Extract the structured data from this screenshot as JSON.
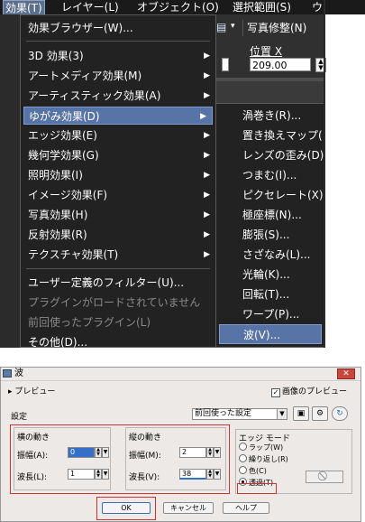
{
  "menubar": {
    "items": [
      "効果(T)",
      "レイヤー(L)",
      "オブジェクト(O)",
      "選択範囲(S)",
      "ウ"
    ]
  },
  "toolbar": {
    "photo_label": "写真修整(N)",
    "position_label": "位置 X",
    "position_value": "209.00"
  },
  "effects_menu": {
    "items": [
      {
        "label": "効果ブラウザー(W)...",
        "submenu": false,
        "state": "normal"
      },
      {
        "label": "3D 効果(3)",
        "submenu": true,
        "state": "normal"
      },
      {
        "label": "アートメディア効果(M)",
        "submenu": true,
        "state": "normal"
      },
      {
        "label": "アーティスティック効果(A)",
        "submenu": true,
        "state": "normal"
      },
      {
        "label": "ゆがみ効果(D)",
        "submenu": true,
        "state": "highlighted"
      },
      {
        "label": "エッジ効果(E)",
        "submenu": true,
        "state": "normal"
      },
      {
        "label": "幾何学効果(G)",
        "submenu": true,
        "state": "normal"
      },
      {
        "label": "照明効果(I)",
        "submenu": true,
        "state": "normal"
      },
      {
        "label": "イメージ効果(F)",
        "submenu": true,
        "state": "normal"
      },
      {
        "label": "写真効果(H)",
        "submenu": true,
        "state": "normal"
      },
      {
        "label": "反射効果(R)",
        "submenu": true,
        "state": "normal"
      },
      {
        "label": "テクスチャ効果(T)",
        "submenu": true,
        "state": "normal"
      },
      {
        "label": "ユーザー定義のフィルター(U)...",
        "submenu": false,
        "state": "normal"
      },
      {
        "label": "プラグインがロードされていません",
        "submenu": false,
        "state": "disabled"
      },
      {
        "label": "前回使ったプラグイン(L)",
        "submenu": false,
        "state": "disabled"
      },
      {
        "label": "その他(D)...",
        "submenu": false,
        "state": "normal"
      }
    ]
  },
  "distortion_submenu": {
    "items": [
      {
        "label": "渦巻き(R)...",
        "state": "normal"
      },
      {
        "label": "置き換えマップ(",
        "state": "normal"
      },
      {
        "label": "レンズの歪み(D)",
        "state": "normal"
      },
      {
        "label": "つまむ(I)...",
        "state": "normal"
      },
      {
        "label": "ピクセレート(X)",
        "state": "normal"
      },
      {
        "label": "極座標(N)...",
        "state": "normal"
      },
      {
        "label": "膨張(S)...",
        "state": "normal"
      },
      {
        "label": "さざなみ(L)...",
        "state": "normal"
      },
      {
        "label": "光輪(K)...",
        "state": "normal"
      },
      {
        "label": "回転(T)...",
        "state": "normal"
      },
      {
        "label": "ワープ(P)...",
        "state": "normal"
      },
      {
        "label": "波(V)...",
        "state": "highlighted"
      }
    ]
  },
  "dialog": {
    "title": "波",
    "close_label": "✕",
    "preview_toggle": "▸ プレビュー",
    "image_preview_label": "画像のプレビュー",
    "image_preview_checked": true,
    "preset_label": "設定",
    "preset_value": "前回使った設定",
    "horizontal": {
      "title": "横の動き",
      "amplitude_label": "振幅(A):",
      "amplitude_value": "0",
      "wavelength_label": "波長(L):",
      "wavelength_value": "1"
    },
    "vertical": {
      "title": "縦の動き",
      "amplitude_label": "振幅(M):",
      "amplitude_value": "2",
      "wavelength_label": "波長(V):",
      "wavelength_value": "38"
    },
    "edge_mode": {
      "title": "エッジ モード",
      "options": [
        "ラップ(W)",
        "繰り返し(R)",
        "色(C)",
        "透過(T)"
      ],
      "selected": "透過(T)"
    },
    "buttons": {
      "ok": "OK",
      "cancel": "キャンセル",
      "help": "ヘルプ"
    }
  },
  "colors": {
    "menu_bg": "#222222",
    "highlight": "#5874a6",
    "dialog_bg": "#ece9e6",
    "annotation_red": "#cc3333"
  }
}
